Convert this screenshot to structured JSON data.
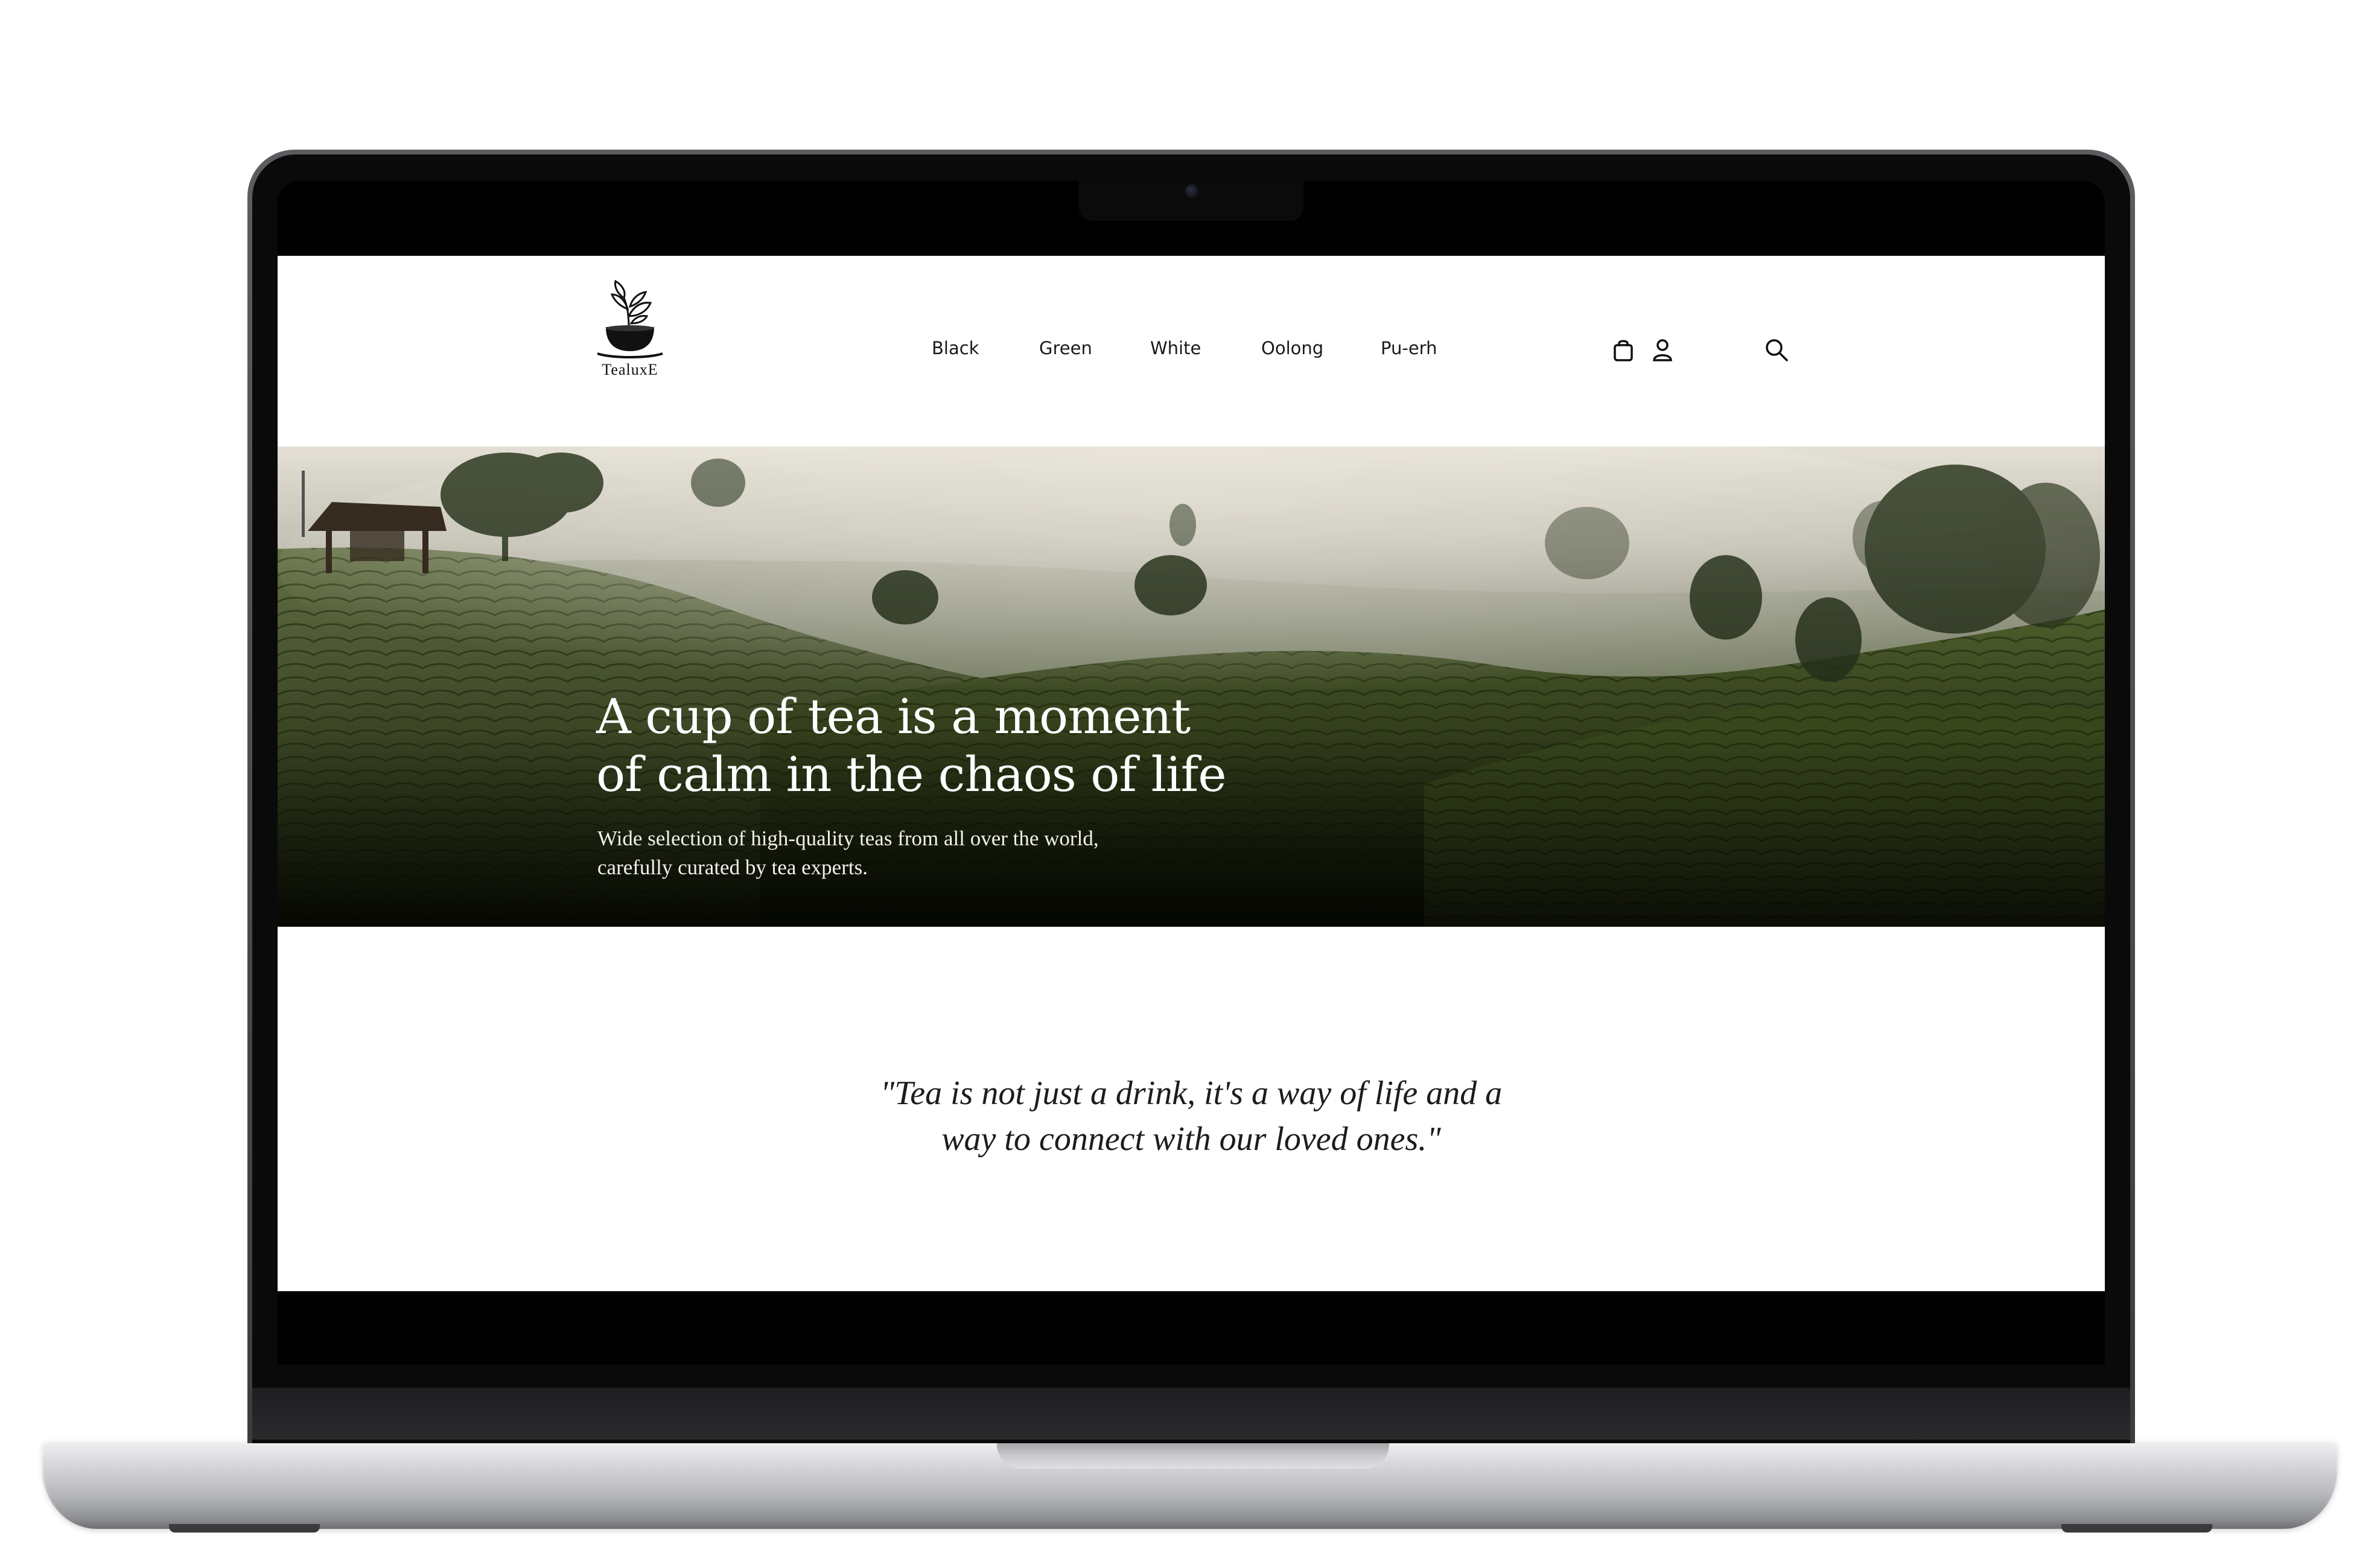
{
  "site": {
    "brand": "TealuxE",
    "nav": {
      "items": [
        {
          "label": "Black"
        },
        {
          "label": "Green"
        },
        {
          "label": "White"
        },
        {
          "label": "Oolong"
        },
        {
          "label": "Pu-erh"
        }
      ],
      "icons": [
        "bag-icon",
        "user-icon",
        "search-icon"
      ]
    },
    "hero": {
      "title_line1": "A cup of tea is a moment",
      "title_line2": "of calm in the chaos of life",
      "subtitle_line1": "Wide selection of high-quality teas from all over the world,",
      "subtitle_line2": "carefully curated by tea experts."
    },
    "quote": {
      "line1": "\"Tea is not just a drink, it's a way of life and a",
      "line2": "way to connect with our loved ones.\""
    }
  },
  "device": {
    "type": "laptop",
    "color": "silver"
  }
}
